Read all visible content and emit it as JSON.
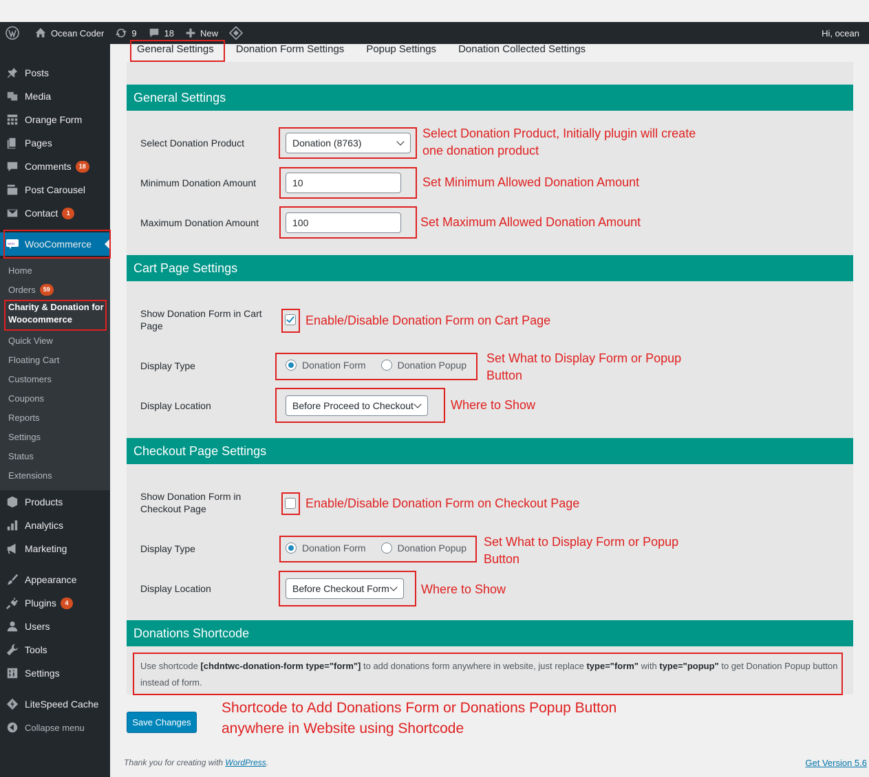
{
  "admin_bar": {
    "site_name": "Ocean Coder",
    "updates_count": "9",
    "comments_count": "18",
    "new_label": "New",
    "greeting": "Hi, ocean"
  },
  "sidebar": {
    "menu": [
      {
        "label": "Posts"
      },
      {
        "label": "Media"
      },
      {
        "label": "Orange Form"
      },
      {
        "label": "Pages"
      },
      {
        "label": "Comments",
        "badge": "18"
      },
      {
        "label": "Post Carousel"
      },
      {
        "label": "Contact",
        "badge": "1"
      },
      {
        "label": "WooCommerce"
      }
    ],
    "woo_submenu": [
      {
        "label": "Home"
      },
      {
        "label": "Orders",
        "badge": "59"
      },
      {
        "label": "Charity & Donation for Woocommerce"
      },
      {
        "label": "Quick View"
      },
      {
        "label": "Floating Cart"
      },
      {
        "label": "Customers"
      },
      {
        "label": "Coupons"
      },
      {
        "label": "Reports"
      },
      {
        "label": "Settings"
      },
      {
        "label": "Status"
      },
      {
        "label": "Extensions"
      }
    ],
    "menu_lower": [
      {
        "label": "Products"
      },
      {
        "label": "Analytics"
      },
      {
        "label": "Marketing"
      },
      {
        "label": "Appearance"
      },
      {
        "label": "Plugins",
        "badge": "4"
      },
      {
        "label": "Users"
      },
      {
        "label": "Tools"
      },
      {
        "label": "Settings"
      },
      {
        "label": "LiteSpeed Cache"
      },
      {
        "label": "Collapse menu"
      }
    ]
  },
  "tabs": [
    "General Settings",
    "Donation Form Settings",
    "Popup Settings",
    "Donation Collected Settings"
  ],
  "general": {
    "title": "General Settings",
    "product_label": "Select Donation Product",
    "product_value": "Donation (8763)",
    "min_label": "Minimum Donation Amount",
    "min_value": "10",
    "max_label": "Maximum Donation Amount",
    "max_value": "100"
  },
  "cart": {
    "title": "Cart Page Settings",
    "show_label": "Show Donation Form in Cart Page",
    "display_type_label": "Display Type",
    "option_form": "Donation Form",
    "option_popup": "Donation Popup",
    "location_label": "Display Location",
    "location_value": "Before Proceed to Checkout"
  },
  "checkout": {
    "title": "Checkout Page Settings",
    "show_label": "Show Donation Form in Checkout Page",
    "display_type_label": "Display Type",
    "option_form": "Donation Form",
    "option_popup": "Donation Popup",
    "location_label": "Display Location",
    "location_value": "Before Checkout Form"
  },
  "shortcode": {
    "title": "Donations Shortcode",
    "part1": "Use shortcode ",
    "code1": "[chdntwc-donation-form type=\"form\"]",
    "part2": " to add donations form anywhere in website, just replace ",
    "code2": "type=\"form\"",
    "part3": " with ",
    "code3": "type=\"popup\"",
    "part4": " to get Donation Popup  button instead of form."
  },
  "annotations": {
    "product": "Select Donation Product, Initially plugin will create one donation product",
    "min": "Set Minimum Allowed Donation Amount",
    "max": "Set Maximum Allowed Donation Amount",
    "cart_enable": "Enable/Disable Donation Form on Cart Page",
    "cart_type": "Set What to Display Form or Popup Button",
    "cart_location": "Where to Show",
    "checkout_enable": "Enable/Disable Donation Form on Checkout Page",
    "checkout_type": "Set What to Display Form or Popup Button",
    "checkout_location": "Where to Show",
    "shortcode": "Shortcode to Add Donations Form or Donations Popup Button anywhere in Website using Shortcode"
  },
  "save_label": "Save Changes",
  "footer": {
    "thanks_prefix": "Thank you for creating with ",
    "wordpress_link": "WordPress",
    "thanks_suffix": ".",
    "version": "Get Version 5.6"
  },
  "colors": {
    "section_header": "#009688",
    "annotation": "#e02020",
    "admin_dark": "#23282d",
    "woo_active": "#0073aa"
  }
}
